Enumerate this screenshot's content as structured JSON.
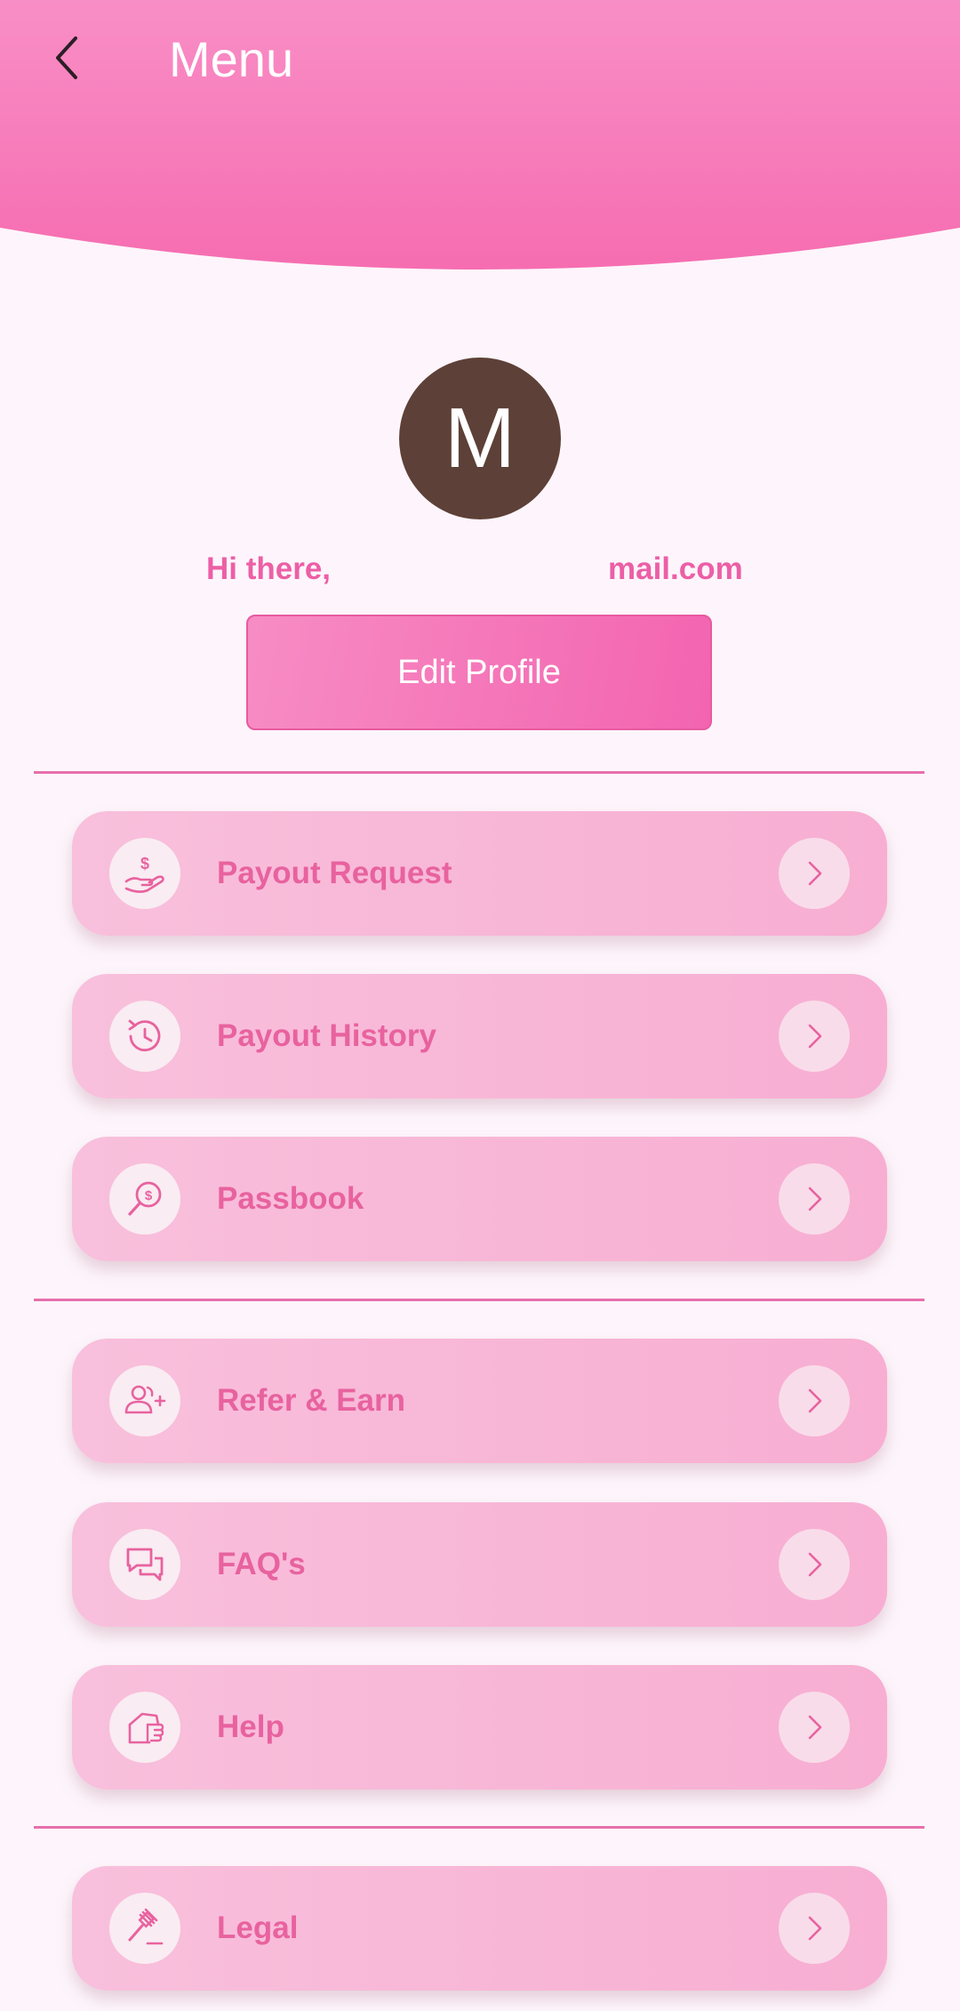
{
  "header": {
    "title": "Menu",
    "back_icon": "chevron-left-icon",
    "gradient_colors": [
      "#f88ec6",
      "#f66fb2"
    ]
  },
  "profile": {
    "avatar_initial": "M",
    "avatar_color": "#5d4037",
    "greeting": "Hi there,",
    "email_visible": "mail.com",
    "edit_button_label": "Edit Profile"
  },
  "menu": {
    "sections": [
      {
        "items": [
          {
            "label": "Payout Request",
            "icon": "money-hand-icon"
          },
          {
            "label": "Payout History",
            "icon": "history-icon"
          },
          {
            "label": "Passbook",
            "icon": "money-search-icon"
          }
        ]
      },
      {
        "items": [
          {
            "label": "Refer & Earn",
            "icon": "add-user-icon"
          },
          {
            "label": "FAQ's",
            "icon": "chat-bubbles-icon"
          },
          {
            "label": "Help",
            "icon": "help-hand-icon"
          }
        ]
      },
      {
        "items": [
          {
            "label": "Legal",
            "icon": "gavel-icon"
          }
        ]
      }
    ],
    "arrow_icon": "chevron-right-icon"
  },
  "colors": {
    "accent": "#ec5fa6",
    "background": "#fdf5fb",
    "card": "#f8bad8"
  }
}
